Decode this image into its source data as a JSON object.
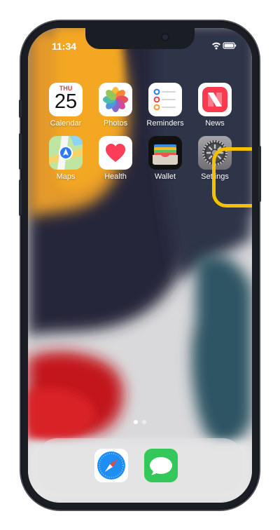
{
  "status_bar": {
    "time": "11:34"
  },
  "apps": [
    {
      "label": "Calendar"
    },
    {
      "label": "Photos"
    },
    {
      "label": "Reminders"
    },
    {
      "label": "News"
    },
    {
      "label": "Maps"
    },
    {
      "label": "Health"
    },
    {
      "label": "Wallet"
    },
    {
      "label": "Settings"
    }
  ],
  "calendar_icon": {
    "weekday": "THU",
    "day": "25"
  },
  "page_dots": {
    "count": 2,
    "active_index": 0
  },
  "dock": [
    {
      "icon": "safari-icon"
    },
    {
      "icon": "messages-icon"
    }
  ],
  "colors": {
    "highlight": "#f5c000",
    "accent_red": "#e53935"
  }
}
